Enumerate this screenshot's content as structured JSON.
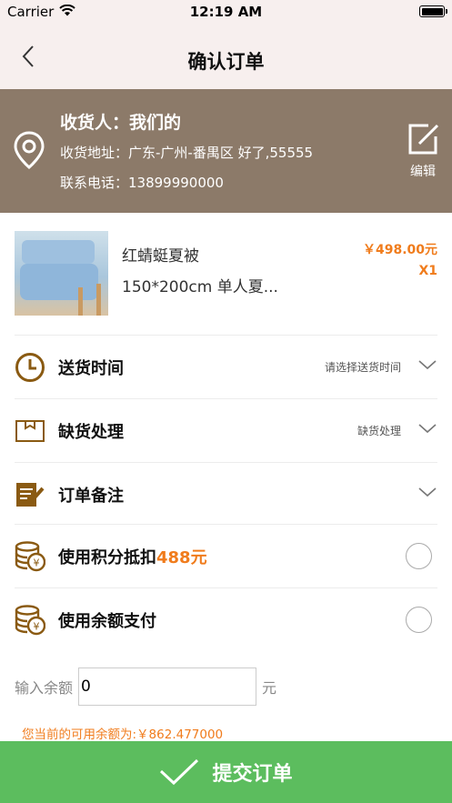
{
  "status_bar": {
    "carrier": "Carrier",
    "time": "12:19 AM"
  },
  "nav": {
    "title": "确认订单"
  },
  "address": {
    "receiver": "收货人：我们的",
    "address": "收货地址：广东-广州-番禺区 好了,55555",
    "phone": "联系电话：13899990000",
    "edit_label": "编辑"
  },
  "product": {
    "name": "红蜻蜓夏被",
    "spec": "150*200cm 单人夏...",
    "price": "￥498.00元",
    "quantity": "X1"
  },
  "options": {
    "delivery": {
      "label": "送货时间",
      "value": "请选择送货时间"
    },
    "stockout": {
      "label": "缺货处理",
      "value": "缺货处理"
    },
    "remark": {
      "label": "订单备注"
    },
    "points": {
      "label": "使用积分抵扣",
      "amount": "488元"
    },
    "balance": {
      "label": "使用余额支付"
    }
  },
  "balance_input": {
    "label": "输入余额",
    "value": "0",
    "unit": "元",
    "available_note": "您当前的可用余额为:￥862.477000"
  },
  "submit": {
    "label": "提交订单"
  },
  "colors": {
    "accent": "#f07c1c",
    "card": "#8c7a69",
    "submit": "#5cbd5e",
    "icon": "#8a5a12"
  }
}
